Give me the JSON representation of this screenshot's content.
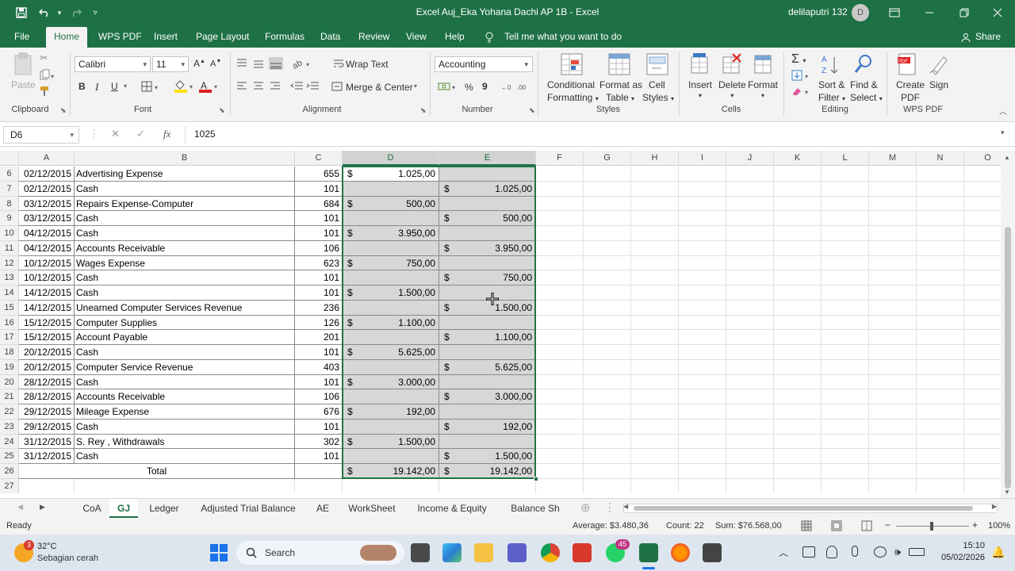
{
  "titlebar": {
    "title": "Excel Auj_Eka Yohana Dachi AP 1B  -  Excel",
    "user_name": "delilaputri 132",
    "avatar_initial": "D"
  },
  "menu": {
    "file": "File",
    "home": "Home",
    "wps_pdf": "WPS PDF",
    "insert": "Insert",
    "page_layout": "Page Layout",
    "formulas": "Formulas",
    "data": "Data",
    "review": "Review",
    "view": "View",
    "help": "Help",
    "tell_me": "Tell me what you want to do",
    "share": "Share"
  },
  "ribbon": {
    "clipboard": {
      "paste": "Paste",
      "label": "Clipboard"
    },
    "font": {
      "name": "Calibri",
      "size": "11",
      "bold": "B",
      "italic": "I",
      "underline": "U",
      "label": "Font"
    },
    "alignment": {
      "wrap_text": "Wrap Text",
      "merge_center": "Merge & Center",
      "label": "Alignment"
    },
    "number": {
      "format": "Accounting",
      "percent": "%",
      "comma": "9",
      "label": "Number"
    },
    "styles": {
      "conditional_1": "Conditional",
      "conditional_2": "Formatting",
      "format_as_1": "Format as",
      "format_as_2": "Table",
      "cell_styles_1": "Cell",
      "cell_styles_2": "Styles",
      "label": "Styles"
    },
    "cells": {
      "insert": "Insert",
      "delete": "Delete",
      "format": "Format",
      "label": "Cells"
    },
    "editing": {
      "sort_1": "Sort &",
      "sort_2": "Filter",
      "find_1": "Find &",
      "find_2": "Select",
      "label": "Editing"
    },
    "wps": {
      "create_1": "Create",
      "create_2": "PDF",
      "sign": "Sign",
      "label": "WPS PDF"
    }
  },
  "formula_bar": {
    "name_box": "D6",
    "fx": "fx",
    "value": "1025"
  },
  "columns": [
    "A",
    "B",
    "C",
    "D",
    "E",
    "F",
    "G",
    "H",
    "I",
    "J",
    "K",
    "L",
    "M",
    "N",
    "O"
  ],
  "rows": [
    {
      "num": "6",
      "date": "02/12/2015",
      "account": "Advertising Expense",
      "ref": "655",
      "debit": "1.025,00",
      "credit": ""
    },
    {
      "num": "7",
      "date": "02/12/2015",
      "account": "Cash",
      "ref": "101",
      "debit": "",
      "credit": "1.025,00"
    },
    {
      "num": "8",
      "date": "03/12/2015",
      "account": "Repairs Expense-Computer",
      "ref": "684",
      "debit": "500,00",
      "credit": ""
    },
    {
      "num": "9",
      "date": "03/12/2015",
      "account": "Cash",
      "ref": "101",
      "debit": "",
      "credit": "500,00"
    },
    {
      "num": "10",
      "date": "04/12/2015",
      "account": "Cash",
      "ref": "101",
      "debit": "3.950,00",
      "credit": ""
    },
    {
      "num": "11",
      "date": "04/12/2015",
      "account": "Accounts Receivable",
      "ref": "106",
      "debit": "",
      "credit": "3.950,00"
    },
    {
      "num": "12",
      "date": "10/12/2015",
      "account": "Wages Expense",
      "ref": "623",
      "debit": "750,00",
      "credit": ""
    },
    {
      "num": "13",
      "date": "10/12/2015",
      "account": "Cash",
      "ref": "101",
      "debit": "",
      "credit": "750,00"
    },
    {
      "num": "14",
      "date": "14/12/2015",
      "account": "Cash",
      "ref": "101",
      "debit": "1.500,00",
      "credit": ""
    },
    {
      "num": "15",
      "date": "14/12/2015",
      "account": "Unearned Computer Services Revenue",
      "ref": "236",
      "debit": "",
      "credit": "1.500,00"
    },
    {
      "num": "16",
      "date": "15/12/2015",
      "account": "Computer Supplies",
      "ref": "126",
      "debit": "1.100,00",
      "credit": ""
    },
    {
      "num": "17",
      "date": "15/12/2015",
      "account": "Account Payable",
      "ref": "201",
      "debit": "",
      "credit": "1.100,00"
    },
    {
      "num": "18",
      "date": "20/12/2015",
      "account": "Cash",
      "ref": "101",
      "debit": "5.625,00",
      "credit": ""
    },
    {
      "num": "19",
      "date": "20/12/2015",
      "account": "Computer Service Revenue",
      "ref": "403",
      "debit": "",
      "credit": "5.625,00"
    },
    {
      "num": "20",
      "date": "28/12/2015",
      "account": "Cash",
      "ref": "101",
      "debit": "3.000,00",
      "credit": ""
    },
    {
      "num": "21",
      "date": "28/12/2015",
      "account": "Accounts Receivable",
      "ref": "106",
      "debit": "",
      "credit": "3.000,00"
    },
    {
      "num": "22",
      "date": "29/12/2015",
      "account": "Mileage Expense",
      "ref": "676",
      "debit": "192,00",
      "credit": ""
    },
    {
      "num": "23",
      "date": "29/12/2015",
      "account": "Cash",
      "ref": "101",
      "debit": "",
      "credit": "192,00"
    },
    {
      "num": "24",
      "date": "31/12/2015",
      "account": "S. Rey , Withdrawals",
      "ref": "302",
      "debit": "1.500,00",
      "credit": ""
    },
    {
      "num": "25",
      "date": "31/12/2015",
      "account": "Cash",
      "ref": "101",
      "debit": "",
      "credit": "1.500,00"
    }
  ],
  "total_row": {
    "num": "26",
    "label": "Total",
    "debit": "19.142,00",
    "credit": "19.142,00"
  },
  "empty_rows": [
    "27"
  ],
  "currency_symbol": "$",
  "sheet_tabs": [
    "CoA",
    "GJ",
    "Ledger",
    "Adjusted Trial Balance",
    "AE",
    "WorkSheet",
    "Income & Equity",
    "Balance Sh"
  ],
  "active_tab": "GJ",
  "status": {
    "ready": "Ready",
    "average": "Average: $3.480,36",
    "count": "Count: 22",
    "sum": "Sum: $76.568,00",
    "zoom": "100%"
  },
  "taskbar": {
    "weather_temp": "32°C",
    "weather_desc": "Sebagian cerah",
    "weather_badge": "3",
    "search": "Search",
    "whatsapp_badge": "45",
    "time": "15:10",
    "date": "05/02/2026"
  }
}
